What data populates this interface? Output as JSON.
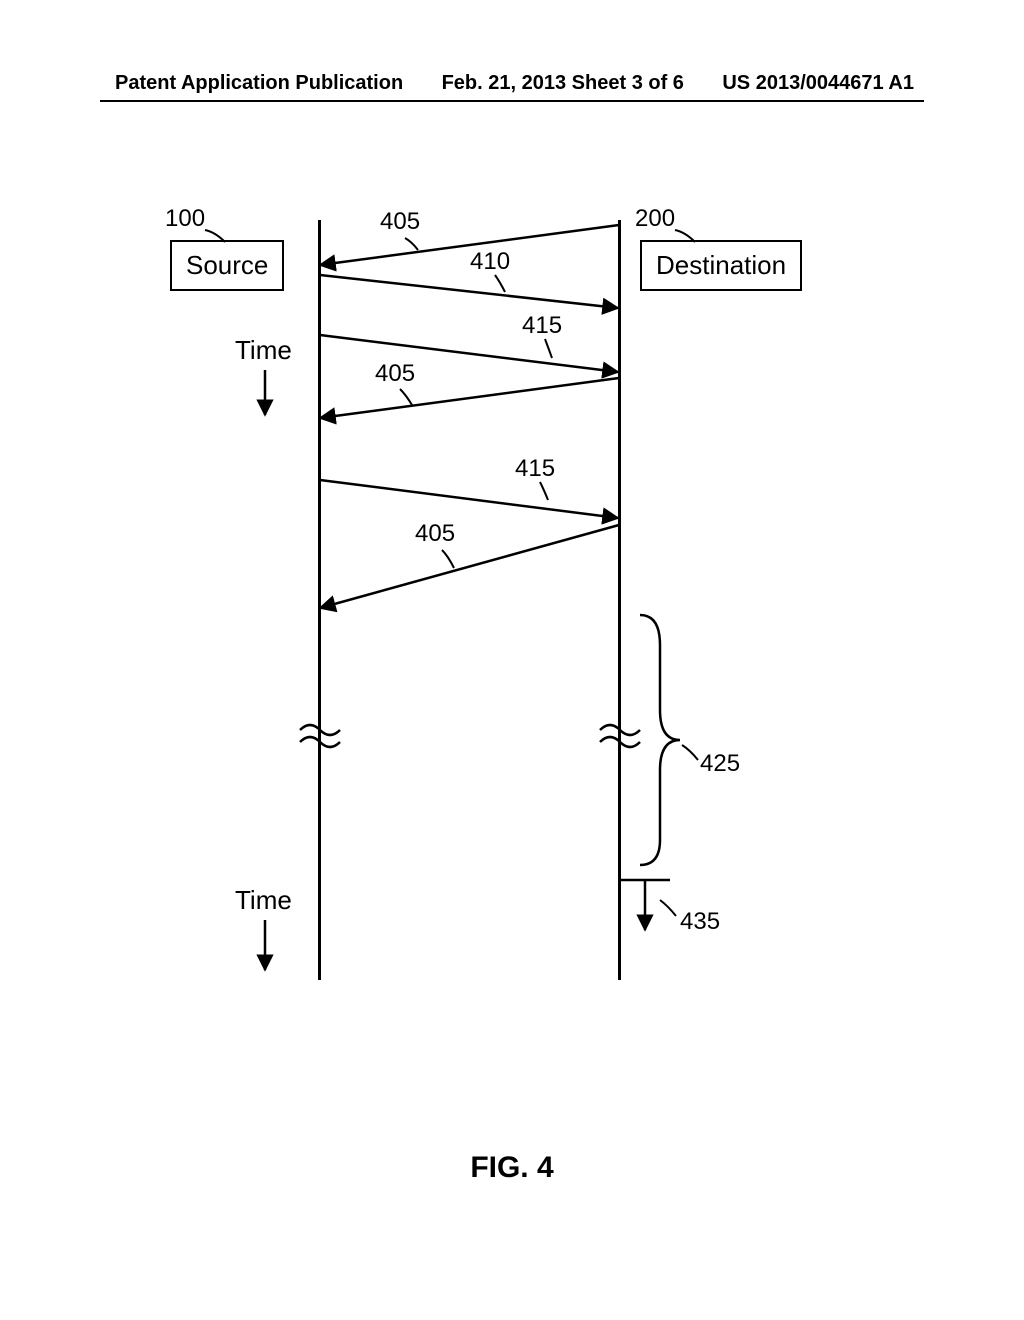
{
  "header": {
    "left": "Patent Application Publication",
    "center": "Feb. 21, 2013  Sheet 3 of 6",
    "right": "US 2013/0044671 A1"
  },
  "boxes": {
    "source": "Source",
    "destination": "Destination"
  },
  "refs": {
    "r100": "100",
    "r200": "200",
    "r405a": "405",
    "r410": "410",
    "r415a": "415",
    "r405b": "405",
    "r415b": "415",
    "r405c": "405",
    "r425": "425",
    "r435": "435"
  },
  "labels": {
    "time": "Time"
  },
  "figure": "FIG. 4"
}
